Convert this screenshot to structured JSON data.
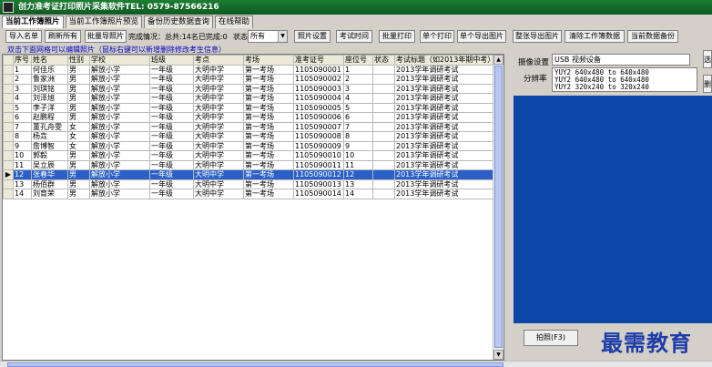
{
  "window": {
    "title": "创力准考证打印照片采集软件TEL: 0579-87566216"
  },
  "tabs": [
    {
      "label": "当前工作簿照片"
    },
    {
      "label": "当前工作簿照片预览"
    },
    {
      "label": "备份历史数据查询"
    },
    {
      "label": "在线帮助"
    }
  ],
  "toolbar": {
    "import_list": "导入名单",
    "refresh_all": "刷新所有",
    "batch_import_photos": "批量导照片",
    "completion": "完成情况：总共:14名已完成:0",
    "status_label": "状态",
    "status_value": "所有",
    "photo_settings": "照片设置",
    "exam_time": "考试时间",
    "batch_print": "批量打印",
    "single_print": "单个打印",
    "single_export": "单个导出图片",
    "full_export": "整张导出图片",
    "clear_workbook": "清除工作簿数据",
    "backup_current": "当前数据备份"
  },
  "hint": "双击下面网格可以编辑照片（鼠标右键可以新增删除修改考生信息）",
  "table": {
    "columns": [
      "序号",
      "姓名",
      "性别",
      "学校",
      "班级",
      "考点",
      "考场",
      "准考证号",
      "座位号",
      "状态",
      "考试标题（如2013年期中考）"
    ],
    "rows": [
      [
        "1",
        "何佳乐",
        "男",
        "解放小学",
        "一年级",
        "大明中学",
        "第一考场",
        "1105090001",
        "1",
        "",
        "2013学年调研考试"
      ],
      [
        "2",
        "鲁家洲",
        "男",
        "解放小学",
        "一年级",
        "大明中学",
        "第一考场",
        "1105090002",
        "2",
        "",
        "2013学年调研考试"
      ],
      [
        "3",
        "刘琪铭",
        "男",
        "解放小学",
        "一年级",
        "大明中学",
        "第一考场",
        "1105090003",
        "3",
        "",
        "2013学年调研考试"
      ],
      [
        "4",
        "刘泽旭",
        "男",
        "解放小学",
        "一年级",
        "大明中学",
        "第一考场",
        "1105090004",
        "4",
        "",
        "2013学年调研考试"
      ],
      [
        "5",
        "李子洋",
        "男",
        "解放小学",
        "一年级",
        "大明中学",
        "第一考场",
        "1105090005",
        "5",
        "",
        "2013学年调研考试"
      ],
      [
        "6",
        "赵鹏程",
        "男",
        "解放小学",
        "一年级",
        "大明中学",
        "第一考场",
        "1105090006",
        "6",
        "",
        "2013学年调研考试"
      ],
      [
        "7",
        "董孔舟雯",
        "女",
        "解放小学",
        "一年级",
        "大明中学",
        "第一考场",
        "1105090007",
        "7",
        "",
        "2013学年调研考试"
      ],
      [
        "8",
        "杨垚",
        "女",
        "解放小学",
        "一年级",
        "大明中学",
        "第一考场",
        "1105090008",
        "8",
        "",
        "2013学年调研考试"
      ],
      [
        "9",
        "詹博智",
        "女",
        "解放小学",
        "一年级",
        "大明中学",
        "第一考场",
        "1105090009",
        "9",
        "",
        "2013学年调研考试"
      ],
      [
        "10",
        "郭毅",
        "男",
        "解放小学",
        "一年级",
        "大明中学",
        "第一考场",
        "1105090010",
        "10",
        "",
        "2013学年调研考试"
      ],
      [
        "11",
        "吴立辰",
        "男",
        "解放小学",
        "一年级",
        "大明中学",
        "第一考场",
        "1105090011",
        "11",
        "",
        "2013学年调研考试"
      ],
      [
        "12",
        "张春华",
        "男",
        "解放小学",
        "一年级",
        "大明中学",
        "第一考场",
        "1105090012",
        "12",
        "",
        "2013学年调研考试"
      ],
      [
        "13",
        "杨佰群",
        "男",
        "解放小学",
        "一年级",
        "大明中学",
        "第一考场",
        "1105090013",
        "13",
        "",
        "2013学年调研考试"
      ],
      [
        "14",
        "刘育荣",
        "男",
        "解放小学",
        "一年级",
        "大明中学",
        "第一考场",
        "1105090014",
        "14",
        "",
        "2013学年调研考试"
      ]
    ],
    "selected_row": 11
  },
  "camera": {
    "device_label": "摄像设置",
    "device_value": "USB 视频设备",
    "resolution_label": "分辨率",
    "resolutions": [
      "YUY2 640x480 to 640x480",
      "YUY2 640x480 to 640x480",
      "YUY2 320x240 to 320x240"
    ],
    "capture_button": "拍照(F3)",
    "side_button_1": "选",
    "side_button_2": "删"
  },
  "watermark": "最需教育",
  "colors": {
    "title_bar": "#1d7d33",
    "selection": "#2a60c8",
    "preview_bg": "#0b46a8",
    "hint_text": "#0000c0"
  }
}
